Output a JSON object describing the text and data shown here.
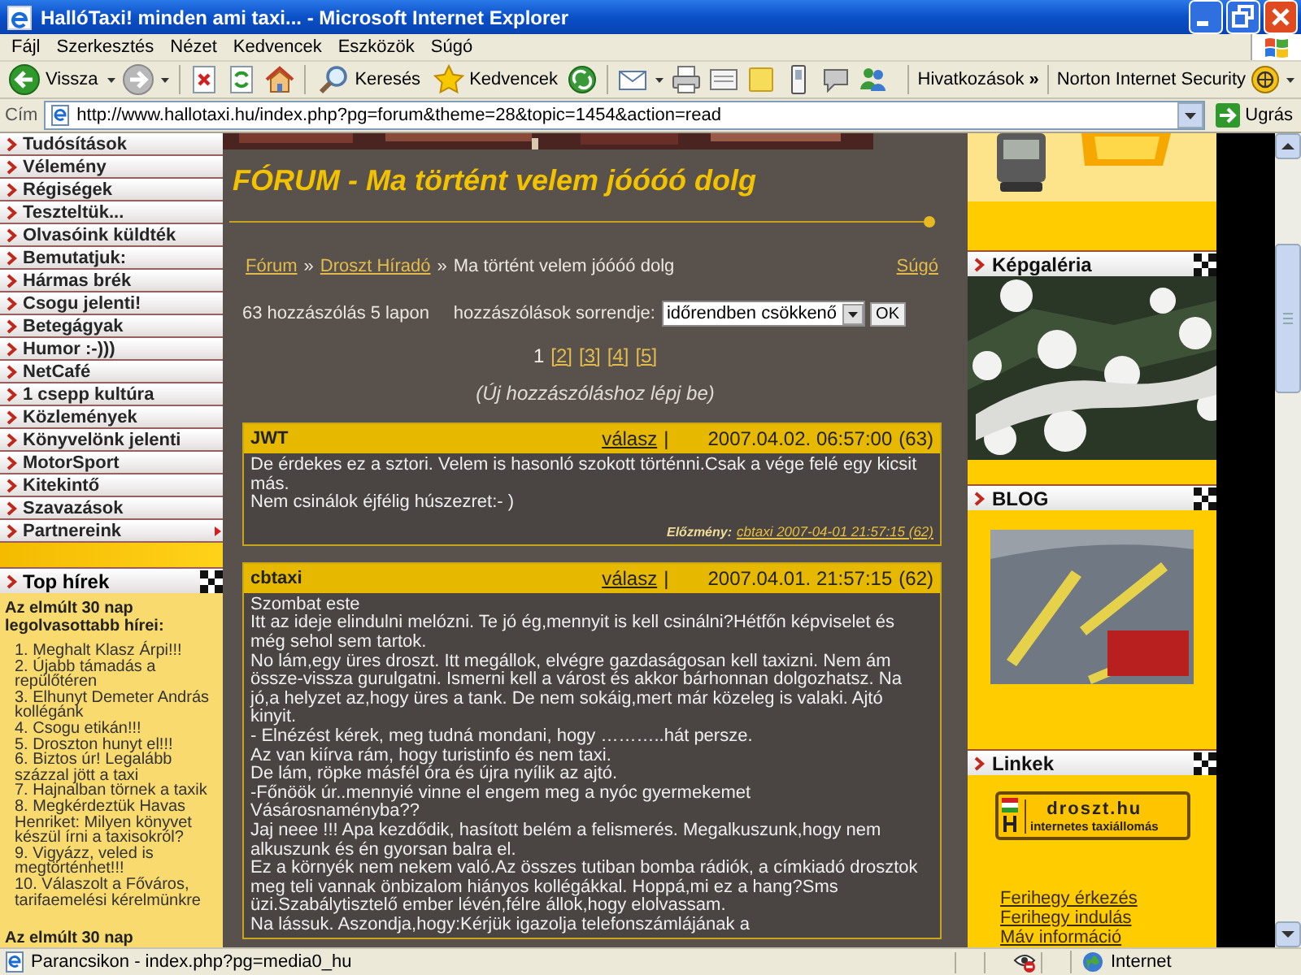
{
  "window": {
    "title": "HallóTaxi! minden ami taxi... - Microsoft Internet Explorer"
  },
  "menu_bar": [
    "Fájl",
    "Szerkesztés",
    "Nézet",
    "Kedvencek",
    "Eszközök",
    "Súgó"
  ],
  "toolbar": [
    {
      "kind": "back",
      "label": "Vissza",
      "dropdown": true
    },
    {
      "kind": "forward",
      "dropdown": true
    },
    {
      "kind": "stop",
      "dropdown": false
    },
    {
      "kind": "refresh",
      "dropdown": false
    },
    {
      "kind": "home",
      "dropdown": false
    },
    {
      "kind": "search",
      "label": "Keresés",
      "dropdown": false
    },
    {
      "kind": "favorites",
      "label": "Kedvencek",
      "dropdown": false
    },
    {
      "kind": "media",
      "dropdown": false
    },
    {
      "kind": "mail",
      "dropdown": true
    },
    {
      "kind": "print",
      "dropdown": false
    },
    {
      "kind": "edit",
      "dropdown": false
    },
    {
      "kind": "note",
      "dropdown": false
    },
    {
      "kind": "messenger",
      "dropdown": false
    },
    {
      "kind": "discuss",
      "dropdown": false
    },
    {
      "kind": "contacts",
      "dropdown": false
    }
  ],
  "links_bar": {
    "label": "Hivatkozások",
    "chevron": "»"
  },
  "norton": {
    "label": "Norton Internet Security"
  },
  "address_bar": {
    "label": "Cím",
    "url": "http://www.hallotaxi.hu/index.php?pg=forum&theme=28&topic=1454&action=read",
    "go": "Ugrás"
  },
  "left_menu": [
    {
      "label": "Tudósítások",
      "has_submenu": false
    },
    {
      "label": "Vélemény",
      "has_submenu": false
    },
    {
      "label": "Régiségek",
      "has_submenu": false
    },
    {
      "label": "Teszteltük...",
      "has_submenu": false
    },
    {
      "label": "Olvasóink küldték",
      "has_submenu": false
    },
    {
      "label": "Bemutatjuk:",
      "has_submenu": false
    },
    {
      "label": "Hármas brék",
      "has_submenu": false
    },
    {
      "label": "Csogu jelenti!",
      "has_submenu": false
    },
    {
      "label": "Betegágyak",
      "has_submenu": false
    },
    {
      "label": "Humor :-)))",
      "has_submenu": false
    },
    {
      "label": "NetCafé",
      "has_submenu": false
    },
    {
      "label": "1 csepp kultúra",
      "has_submenu": false
    },
    {
      "label": "Közlemények",
      "has_submenu": false
    },
    {
      "label": "Könyvelönk jelenti",
      "has_submenu": false
    },
    {
      "label": "MotorSport",
      "has_submenu": false
    },
    {
      "label": "Kitekintő",
      "has_submenu": false
    },
    {
      "label": "Szavazások",
      "has_submenu": false
    },
    {
      "label": "Partnereink",
      "has_submenu": true
    }
  ],
  "top_news": {
    "title": "Top hírek",
    "heading": "Az elmúlt 30 nap legolvasottabb hírei:",
    "items": [
      "1. Meghalt Klasz Árpi!!!",
      "2. Újabb támadás a repülőtéren",
      "3. Elhunyt Demeter András kollégánk",
      "4. Csogu etikán!!!",
      "5. Droszton hunyt el!!!",
      "6. Biztos úr! Legalább százzal jött a taxi",
      "7. Hajnalban törnek a taxik",
      "8. Megkérdeztük Havas Henriket: Milyen könyvet készül írni a taxisokról?",
      "9. Vigyázz, veled is megtörténhet!!!",
      "10. Válaszolt a Főváros, tarifaemelési kérelmünkre"
    ],
    "next_heading": "Az elmúlt 30 nap"
  },
  "forum": {
    "title": "FÓRUM - Ma történt velem jóóóó dolg",
    "breadcrumb": [
      {
        "kind": "link",
        "label": "Fórum"
      },
      {
        "kind": "separator",
        "label": "»"
      },
      {
        "kind": "link",
        "label": "Droszt Híradó"
      },
      {
        "kind": "separator",
        "label": "»"
      },
      {
        "kind": "current",
        "label": "Ma történt velem jóóóó dolg"
      }
    ],
    "help": "Súgó",
    "count": "63 hozzászólás 5 lapon",
    "sort_label": "hozzászólások sorrendje:",
    "sort_value": "időrendben csökkenő",
    "ok": "OK",
    "pages": [
      {
        "label": "1",
        "selected": true
      },
      {
        "label": "[2]",
        "selected": false
      },
      {
        "label": "[3]",
        "selected": false
      },
      {
        "label": "[4]",
        "selected": false
      },
      {
        "label": "[5]",
        "selected": false
      }
    ],
    "login_note": "(Új hozzászóláshoz lépj be)",
    "posts": [
      {
        "author": "JWT",
        "reply": "válasz",
        "separator": "|",
        "date": "2007.04.02. 06:57:00",
        "number": "(63)",
        "body": [
          "De érdekes ez a sztori. Velem is hasonló szokott történni.Csak a vége felé egy kicsit más.",
          "Nem csinálok éjfélig húszezret:- )"
        ],
        "previous_label": "Előzmény:",
        "previous_link": "cbtaxi 2007-04-01 21:57:15 (62)"
      },
      {
        "author": "cbtaxi",
        "reply": "válasz",
        "separator": "|",
        "date": "2007.04.01. 21:57:15",
        "number": "(62)",
        "body": [
          "Szombat este",
          "Itt az ideje elindulni melózni. Te jó ég,mennyit is kell csinálni?Hétfőn képviselet és még sehol sem tartok.",
          "No lám,egy üres droszt. Itt megállok, elvégre gazdaságosan kell taxizni. Nem ám össze-vissza gurulgatni. Ismerni kell a várost és akkor bárhonnan dolgozhatsz. Na jó,a helyzet az,hogy üres a tank. De nem sokáig,mert már közeleg is valaki. Ajtó kinyit.",
          "- Elnézést kérek, meg tudná mondani, hogy ………..hát persze.",
          "Az van kiírva rám, hogy turistinfo és nem taxi.",
          "De lám, röpke másfél óra és újra nyílik az ajtó.",
          "-Főnöök úr..mennyié vinne el engem meg a nyóc gyermekemet",
          "Vásárosnaményba??",
          "Jaj neee !!! Apa kezdődik, hasított belém a felismerés. Megalkuszunk,hogy nem alkuszunk és én gyorsan balra el.",
          "Ez a környék nem nekem való.Az összes tutiban bomba rádiók, a címkiadó drosztok meg teli vannak önbizalom hiányos kollégákkal. Hoppá,mi ez a hang?Sms üzi.Szabálytisztelő ember lévén,félre állok,hogy elolvassam.",
          "Na lássuk. Aszondja,hogy:Kérjük igazolja telefonszámlájának a"
        ]
      }
    ]
  },
  "right": {
    "sections": [
      {
        "kind": "banner"
      },
      {
        "kind": "gallery",
        "title": "Képgaléria"
      },
      {
        "kind": "blog",
        "title": "BLOG"
      },
      {
        "kind": "links",
        "title": "Linkek",
        "logo_name": "droszt.hu",
        "logo_tagline": "internetes taxiállomás",
        "links": [
          "Ferihegy érkezés",
          "Ferihegy indulás",
          "Máv információ"
        ]
      }
    ]
  },
  "status_bar": {
    "text": "Parancsikon - index.php?pg=media0_hu",
    "zone": "Internet"
  }
}
